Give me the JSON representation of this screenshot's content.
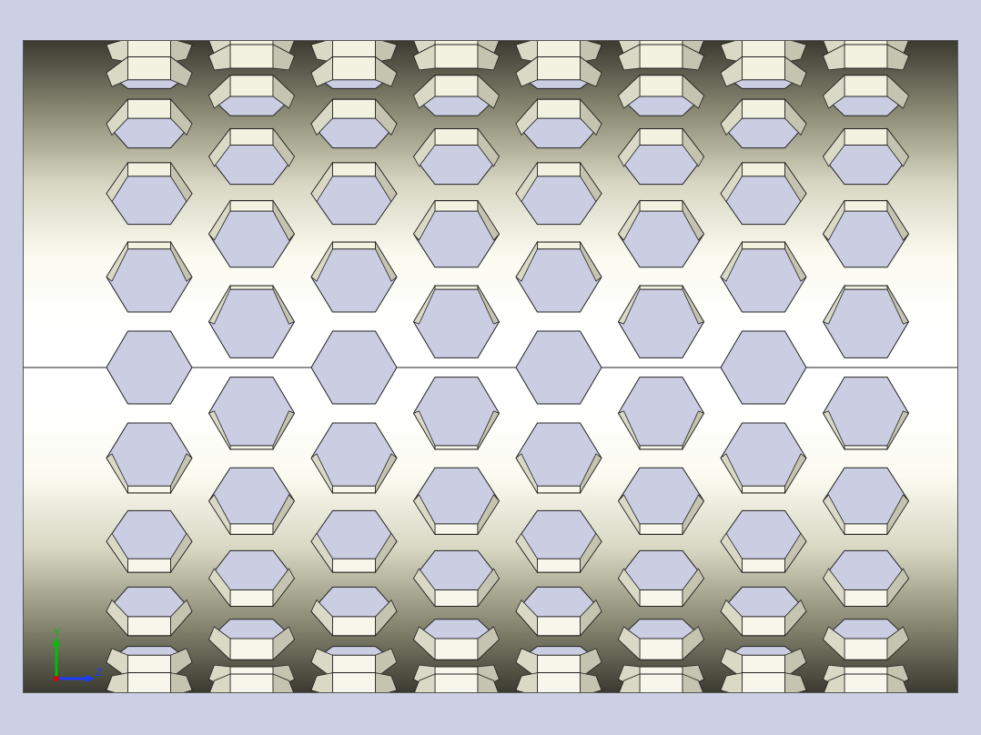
{
  "viewport": {
    "background_color": "#cdcfe4",
    "hole_fill_color": "#cbcde2",
    "cylinder_shading": [
      "#3a3a30",
      "#8c8c76",
      "#d8d8c4",
      "#fbfbf1",
      "#ffffff",
      "#ffffff",
      "#fbfbf1",
      "#d8d8c4",
      "#8c8c76",
      "#3a3a30"
    ]
  },
  "model": {
    "name": "perforated-cylinder",
    "hole_shape": "hexagon",
    "columns": 8,
    "rows": 12
  },
  "triad": {
    "y_label": "Y",
    "z_label": "Z",
    "y_color": "#00c000",
    "z_color": "#1a3cff",
    "x_color": "#e00000"
  }
}
